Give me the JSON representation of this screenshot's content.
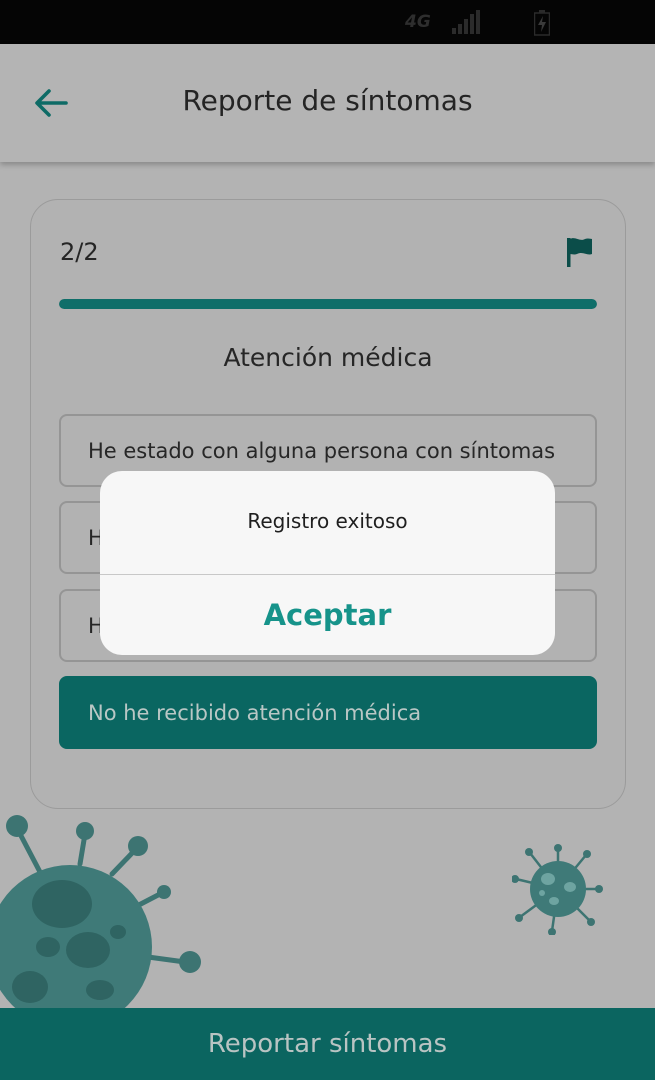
{
  "status_bar": {
    "network": "4G",
    "signal_icon": "signal-bars-icon",
    "battery_icon": "battery-charging-icon"
  },
  "app_bar": {
    "back_icon": "arrow-left-icon",
    "title": "Reporte de síntomas"
  },
  "card": {
    "step": "2/2",
    "flag_icon": "flag-icon",
    "progress": 1.0,
    "section_title": "Atención médica",
    "options": [
      {
        "label": "He estado con alguna persona con síntomas",
        "selected": false
      },
      {
        "label": "H",
        "selected": false
      },
      {
        "label": "H",
        "selected": false
      },
      {
        "label": "No he recibido atención médica",
        "selected": true
      }
    ]
  },
  "decorations": {
    "large_virus": "virus-illustration",
    "small_virus": "virus-illustration"
  },
  "bottom_bar": {
    "label": "Reportar síntomas"
  },
  "dialog": {
    "message": "Registro exitoso",
    "accept_label": "Aceptar"
  },
  "colors": {
    "accent": "#0b6560",
    "dialog_button": "#16938a",
    "overlay": "#b3b3b3"
  }
}
